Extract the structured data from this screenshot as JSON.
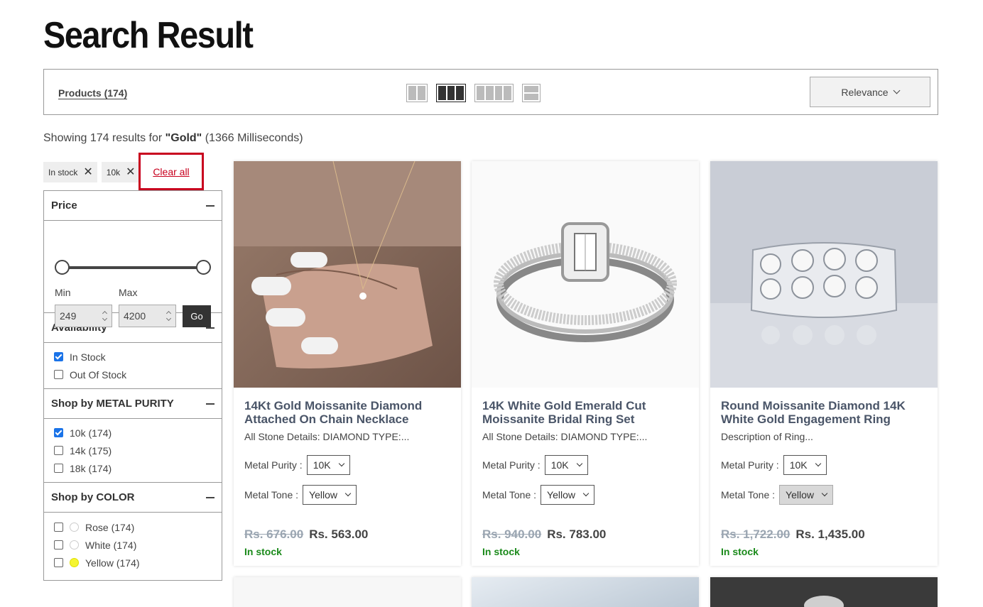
{
  "page": {
    "title": "Search Result"
  },
  "toolbar": {
    "products_label": "Products (174)",
    "sort_label": "Relevance"
  },
  "results": {
    "prefix": "Showing 174 results for ",
    "query": "\"Gold\"",
    "suffix": " (1366 Milliseconds)"
  },
  "chips": [
    {
      "label": "In stock",
      "remove": "✕"
    },
    {
      "label": "10k",
      "remove": "✕"
    }
  ],
  "clear_all": "Clear all",
  "filters": {
    "price": {
      "title": "Price",
      "min_label": "Min",
      "max_label": "Max",
      "min_value": "249",
      "max_value": "4200",
      "go_label": "Go"
    },
    "availability": {
      "title": "Availability",
      "options": [
        {
          "label": "In Stock",
          "checked": true
        },
        {
          "label": "Out Of Stock",
          "checked": false
        }
      ]
    },
    "metal_purity": {
      "title": "Shop by METAL PURITY",
      "options": [
        {
          "label": "10k (174)",
          "checked": true
        },
        {
          "label": "14k (175)",
          "checked": false
        },
        {
          "label": "18k (174)",
          "checked": false
        }
      ]
    },
    "color": {
      "title": "Shop by COLOR",
      "options": [
        {
          "label": "Rose (174)",
          "swatch": "#ffffff"
        },
        {
          "label": "White (174)",
          "swatch": "#ffffff"
        },
        {
          "label": "Yellow (174)",
          "swatch": "#f5f531"
        }
      ]
    }
  },
  "products": [
    {
      "title": "14Kt Gold Moissanite Diamond Attached On Chain Necklace",
      "desc": "All Stone Details: DIAMOND TYPE:...",
      "purity_label": "Metal Purity :",
      "purity": "10K",
      "tone_label": "Metal Tone :",
      "tone": "Yellow",
      "old_price": "Rs. 676.00",
      "price": "Rs. 563.00",
      "stock": "In stock"
    },
    {
      "title": "14K White Gold Emerald Cut Moissanite Bridal Ring Set",
      "desc": "All Stone Details: DIAMOND TYPE:...",
      "purity_label": "Metal Purity :",
      "purity": "10K",
      "tone_label": "Metal Tone :",
      "tone": "Yellow",
      "old_price": "Rs. 940.00",
      "price": "Rs. 783.00",
      "stock": "In stock"
    },
    {
      "title": "Round Moissanite Diamond 14K White Gold Engagement Ring",
      "desc": "Description of Ring...",
      "purity_label": "Metal Purity :",
      "purity": "10K",
      "tone_label": "Metal Tone :",
      "tone": "Yellow",
      "old_price": "Rs. 1,722.00",
      "price": "Rs. 1,435.00",
      "stock": "In stock"
    }
  ],
  "colors": {
    "accent_red": "#c8001e",
    "stock_green": "#1a8a1a",
    "checkbox_blue": "#1a73e8"
  }
}
